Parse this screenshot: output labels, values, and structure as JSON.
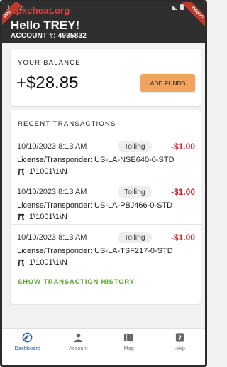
{
  "status_bar": {
    "time": "10:52"
  },
  "watermark": "Apkcheat.org",
  "ribbons": {
    "left": "PRE",
    "right": "DEBUG"
  },
  "header": {
    "greeting": "Hello TREY!",
    "account": "ACCOUNT #: 4935832"
  },
  "balance": {
    "label": "YOUR BALANCE",
    "amount": "+$28.85",
    "add_funds": "ADD FUNDS"
  },
  "transactions": {
    "heading": "RECENT TRANSACTIONS",
    "items": [
      {
        "date": "10/10/2023 8:13 AM",
        "type": "Tolling",
        "amount": "-$1.00",
        "license": "License/Transponder: US-LA-NSE640-0-STD",
        "road": "1\\1001\\1\\N"
      },
      {
        "date": "10/10/2023 8:13 AM",
        "type": "Tolling",
        "amount": "-$1.00",
        "license": "License/Transponder: US-LA-PBJ466-0-STD",
        "road": "1\\1001\\1\\N"
      },
      {
        "date": "10/10/2023 8:13 AM",
        "type": "Tolling",
        "amount": "-$1.00",
        "license": "License/Transponder: US-LA-TSF217-0-STD",
        "road": "1\\1001\\1\\N"
      }
    ],
    "history_link": "SHOW TRANSACTION HISTORY"
  },
  "nav": {
    "items": [
      {
        "label": "Dashboard",
        "icon": "dashboard-logo-icon"
      },
      {
        "label": "Account",
        "icon": "person-icon"
      },
      {
        "label": "Map",
        "icon": "map-icon"
      },
      {
        "label": "Help",
        "icon": "help-icon"
      }
    ],
    "active": "Dashboard"
  },
  "colors": {
    "header": "#2f2f2f",
    "accent_button": "#f0a45d",
    "debit": "#c62828",
    "link": "#5aa52d",
    "nav_active": "#2a5cae"
  }
}
